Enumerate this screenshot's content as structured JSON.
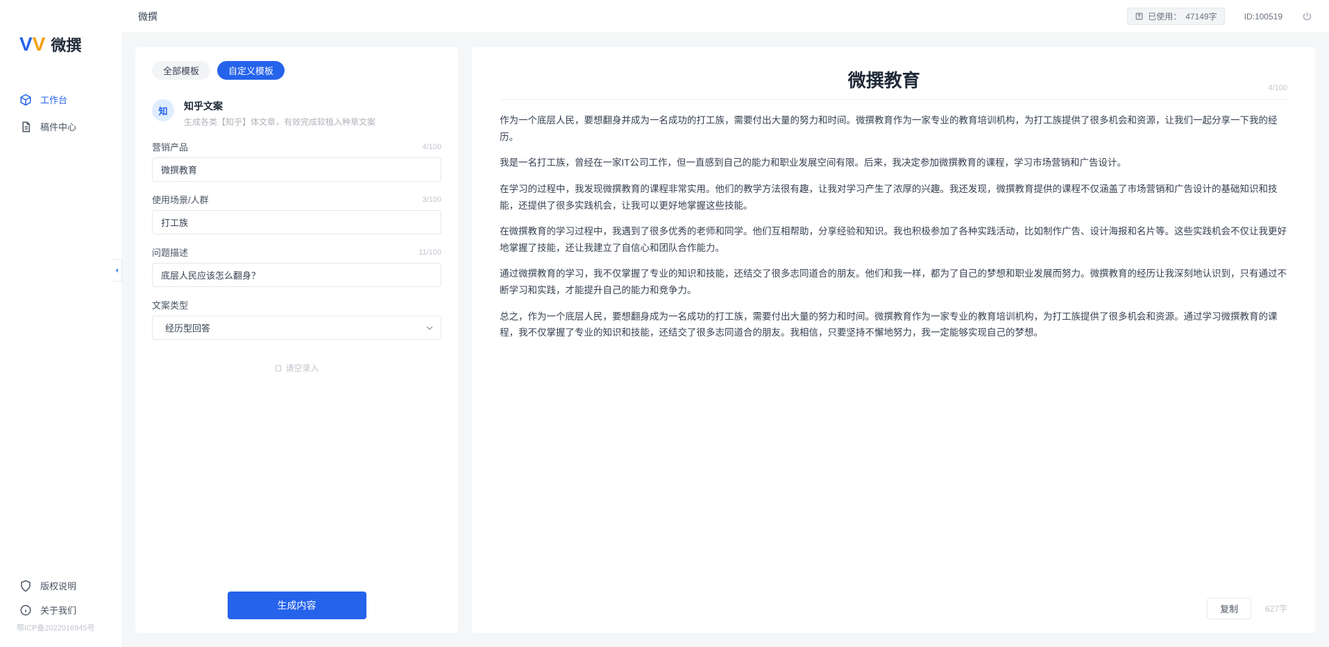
{
  "brand": {
    "name": "微撰"
  },
  "topbar": {
    "title": "微撰",
    "usage_label": "已使用：",
    "usage_value": "47149字",
    "id_label": "ID:100519"
  },
  "sidebar": {
    "items": [
      {
        "label": "工作台",
        "icon": "cube",
        "active": true
      },
      {
        "label": "稿件中心",
        "icon": "doc-edit",
        "active": false
      }
    ],
    "bottom": [
      {
        "label": "版权说明",
        "icon": "shield"
      },
      {
        "label": "关于我们",
        "icon": "info"
      }
    ],
    "footer": "鄂ICP备2022016945号"
  },
  "tabs": [
    {
      "label": "全部模板",
      "active": false
    },
    {
      "label": "自定义模板",
      "active": true
    }
  ],
  "template": {
    "icon_text": "知",
    "title": "知乎文案",
    "desc": "生成各类【知乎】体文章，有效完成软植入种草文案"
  },
  "fields": {
    "product": {
      "label": "营销产品",
      "value": "微撰教育",
      "counter": "4/100"
    },
    "scene": {
      "label": "使用场景/人群",
      "value": "打工族",
      "counter": "3/100"
    },
    "problem": {
      "label": "问题描述",
      "value": "底层人民应该怎么翻身？",
      "counter": "11/100"
    },
    "type": {
      "label": "文案类型",
      "value": "经历型回答"
    }
  },
  "empty_prompt": "请空录入",
  "buttons": {
    "generate": "生成内容",
    "copy": "复制"
  },
  "output": {
    "title": "微撰教育",
    "title_counter": "4/100",
    "char_count": "627字",
    "paragraphs": [
      "作为一个底层人民，要想翻身并成为一名成功的打工族，需要付出大量的努力和时间。微撰教育作为一家专业的教育培训机构，为打工族提供了很多机会和资源，让我们一起分享一下我的经历。",
      "我是一名打工族，曾经在一家IT公司工作，但一直感到自己的能力和职业发展空间有限。后来，我决定参加微撰教育的课程，学习市场营销和广告设计。",
      "在学习的过程中，我发现微撰教育的课程非常实用。他们的教学方法很有趣，让我对学习产生了浓厚的兴趣。我还发现，微撰教育提供的课程不仅涵盖了市场营销和广告设计的基础知识和技能，还提供了很多实践机会，让我可以更好地掌握这些技能。",
      "在微撰教育的学习过程中，我遇到了很多优秀的老师和同学。他们互相帮助，分享经验和知识。我也积极参加了各种实践活动，比如制作广告、设计海报和名片等。这些实践机会不仅让我更好地掌握了技能，还让我建立了自信心和团队合作能力。",
      "通过微撰教育的学习，我不仅掌握了专业的知识和技能，还结交了很多志同道合的朋友。他们和我一样，都为了自己的梦想和职业发展而努力。微撰教育的经历让我深刻地认识到，只有通过不断学习和实践，才能提升自己的能力和竞争力。",
      "总之，作为一个底层人民，要想翻身成为一名成功的打工族，需要付出大量的努力和时间。微撰教育作为一家专业的教育培训机构，为打工族提供了很多机会和资源。通过学习微撰教育的课程，我不仅掌握了专业的知识和技能，还结交了很多志同道合的朋友。我相信，只要坚持不懈地努力，我一定能够实现自己的梦想。"
    ]
  }
}
